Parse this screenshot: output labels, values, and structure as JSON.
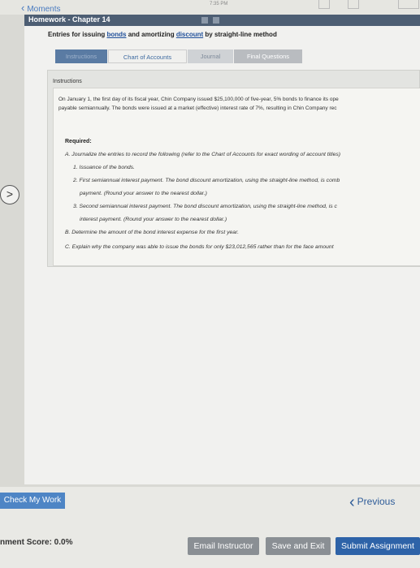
{
  "status_bar": {
    "back_label": "Moments",
    "time": "7:35 PM"
  },
  "window": {
    "title": "Homework - Chapter 14"
  },
  "heading": {
    "part1": "Entries for issuing ",
    "link1": "bonds",
    "part2": " and amortizing ",
    "link2": "discount",
    "part3": " by straight-line method"
  },
  "tabs": [
    {
      "label": "Instructions"
    },
    {
      "label": "Chart of Accounts"
    },
    {
      "label": "Journal"
    },
    {
      "label": "Final Questions"
    }
  ],
  "instructions": {
    "header": "Instructions",
    "intro_line1": "On January 1, the first day of its fiscal year, Chin Company issued $25,100,000 of five-year, 5% bonds to finance its ope",
    "intro_line2": "payable semiannually. The bonds were issued at a market (effective) interest rate of 7%, resulting in Chin Company rec",
    "required_label": "Required:",
    "a": "A.  Journalize the entries to record the following (refer to the Chart of Accounts for exact wording of account titles)",
    "a1": "1.   Issuance of the bonds.",
    "a2_line1": "2.   First semiannual interest payment. The bond discount amortization, using the straight-line method, is comb",
    "a2_line2": "payment. (Round your answer to the nearest dollar.)",
    "a3_line1": "3.   Second semiannual interest payment. The bond discount amortization, using the straight-line method, is c",
    "a3_line2": "interest payment. (Round your answer to the nearest dollar.)",
    "b": "B.  Determine the amount of the bond interest expense for the first year.",
    "c": "C.  Explain why the company was able to issue the bonds for only $23,012,565 rather than for the face amount"
  },
  "footer": {
    "check_label": "Check My Work",
    "previous_label": "Previous",
    "score_label": "nment Score: 0.0%",
    "email_label": "Email Instructor",
    "save_label": "Save and Exit",
    "submit_label": "Submit Assignment"
  }
}
